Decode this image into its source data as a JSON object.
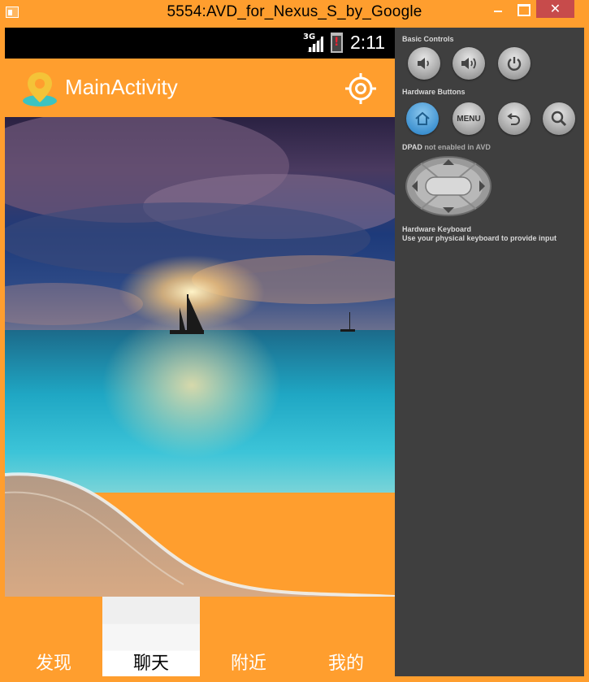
{
  "window": {
    "title": "5554:AVD_for_Nexus_S_by_Google",
    "close_symbol": "✕"
  },
  "statusbar": {
    "network": "3G",
    "time": "2:11"
  },
  "actionbar": {
    "title": "MainActivity",
    "logo_icon": "map-pin-icon",
    "action_icon": "my-location-icon"
  },
  "tabs": [
    {
      "label": "发现",
      "active": false
    },
    {
      "label": "聊天",
      "active": true
    },
    {
      "label": "附近",
      "active": false
    },
    {
      "label": "我的",
      "active": false
    }
  ],
  "controls": {
    "basic_header": "Basic Controls",
    "hardware_header": "Hardware Buttons",
    "dpad_header": "DPAD",
    "dpad_note": "not enabled in AVD",
    "keyboard_header": "Hardware Keyboard",
    "keyboard_note": "Use your physical keyboard to provide input",
    "menu_label": "MENU"
  },
  "colors": {
    "accent": "#ff9e2e",
    "panel": "#3f3f3f",
    "statusbar": "#000000"
  }
}
